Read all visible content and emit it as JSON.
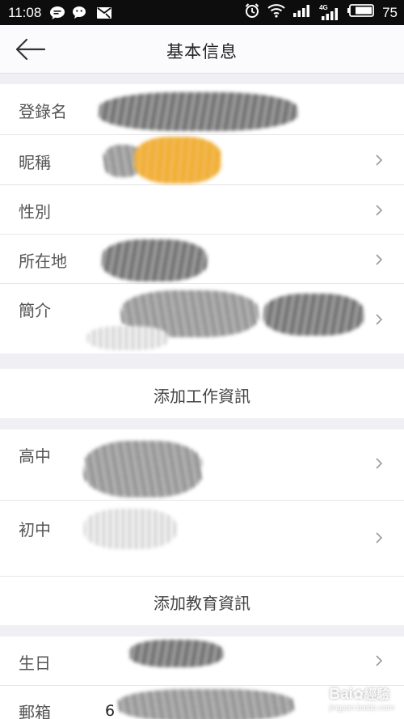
{
  "status_bar": {
    "time": "11:08",
    "battery": "75",
    "left_icons": [
      "chat-bubble-icon",
      "wechat-icon",
      "mail-icon"
    ],
    "right_icons": [
      "alarm-icon",
      "wifi-icon",
      "signal-icon",
      "signal-4g-icon",
      "battery-icon"
    ],
    "network_badge": "4G"
  },
  "header": {
    "title": "基本信息",
    "back_icon": "back-arrow-icon"
  },
  "basic_info": {
    "rows": [
      {
        "label": "登錄名",
        "value": ""
      },
      {
        "label": "昵稱",
        "value": ""
      },
      {
        "label": "性別",
        "value": ""
      },
      {
        "label": "所在地",
        "value": ""
      },
      {
        "label": "簡介",
        "value": ""
      }
    ]
  },
  "work": {
    "add_label": "添加工作資訊"
  },
  "education": {
    "rows": [
      {
        "label": "高中",
        "value": ""
      },
      {
        "label": "初中",
        "value": ""
      }
    ],
    "add_label": "添加教育資訊"
  },
  "contact": {
    "rows": [
      {
        "label": "生日",
        "value": ""
      },
      {
        "label": "郵箱",
        "value": "6"
      }
    ]
  },
  "watermark": {
    "brand": "Bai",
    "suffix": "經驗",
    "url": "jingyan.baidu.com"
  },
  "colors": {
    "status_bar_bg": "#0d0d0d",
    "nav_bg": "#fbfbfd",
    "page_bg": "#f0eff4",
    "card_bg": "#ffffff",
    "label_text": "#555555"
  }
}
